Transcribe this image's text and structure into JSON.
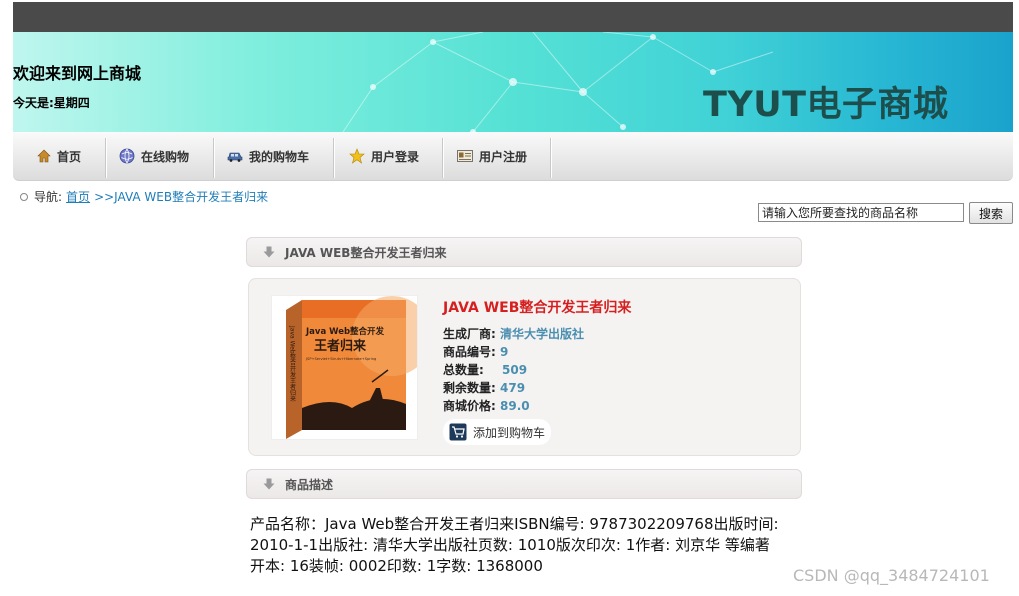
{
  "header": {
    "welcome": "欢迎来到网上商城",
    "today": "今天是:星期四",
    "brand": "TYUT电子商城"
  },
  "nav": {
    "items": [
      {
        "label": "首页",
        "icon": "home-icon"
      },
      {
        "label": "在线购物",
        "icon": "globe-icon"
      },
      {
        "label": "我的购物车",
        "icon": "car-icon"
      },
      {
        "label": "用户登录",
        "icon": "star-icon"
      },
      {
        "label": "用户注册",
        "icon": "id-card-icon"
      }
    ]
  },
  "breadcrumb": {
    "prefix": "导航:",
    "home": "首页",
    "current": ">>JAVA WEB整合开发王者归来"
  },
  "search": {
    "value": "请输入您所要查找的商品名称",
    "button": "搜索"
  },
  "product": {
    "header": "JAVA WEB整合开发王者归来",
    "title": "JAVA WEB整合开发王者归来",
    "manufacturer_label": "生成厂商:",
    "manufacturer": "清华大学出版社",
    "id_label": "商品编号:",
    "id": "9",
    "total_label": "总数量:",
    "total": "509",
    "remaining_label": "剩余数量:",
    "remaining": "479",
    "price_label": "商城价格:",
    "price": "89.0",
    "add_to_cart": "添加到购物车",
    "cover": {
      "title_line1": "Java Web整合开发",
      "title_line2": "王者归来",
      "subtitle": "JSP+Servlet+Struts+Hibernate+Spring",
      "spine": "Java Web整合开发王者归来"
    }
  },
  "description": {
    "header": "商品描述",
    "line1": "产品名称：Java Web整合开发王者归来ISBN编号: 9787302209768出版时间:",
    "line2": "2010-1-1出版社: 清华大学出版社页数: 1010版次印次: 1作者: 刘京华 等编著",
    "line3": "开本: 16装帧: 0002印数: 1字数: 1368000"
  },
  "watermark": "CSDN @qq_3484724101"
}
